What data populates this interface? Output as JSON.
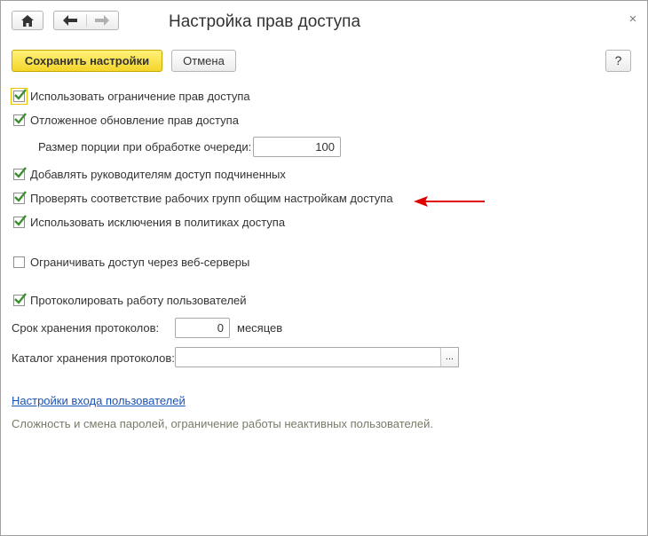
{
  "window": {
    "title": "Настройка прав доступа",
    "close_glyph": "×"
  },
  "toolbar": {
    "save_label": "Сохранить настройки",
    "cancel_label": "Отмена",
    "help_label": "?"
  },
  "settings": {
    "use_restriction": {
      "label": "Использовать ограничение прав доступа",
      "checked": true
    },
    "deferred_update": {
      "label": "Отложенное обновление прав доступа",
      "checked": true
    },
    "batch_size": {
      "label": "Размер порции при обработке очереди:",
      "value": "100"
    },
    "managers_access": {
      "label": "Добавлять руководителям доступ подчиненных",
      "checked": true
    },
    "check_workgroups": {
      "label": "Проверять соответствие рабочих групп общим настройкам доступа",
      "checked": true
    },
    "policy_exceptions": {
      "label": "Использовать исключения в политиках доступа",
      "checked": true
    },
    "web_servers": {
      "label": "Ограничивать доступ через веб-серверы",
      "checked": false
    },
    "log_users": {
      "label": "Протоколировать работу пользователей",
      "checked": true
    },
    "retention": {
      "label": "Срок хранения протоколов:",
      "value": "0",
      "unit": "месяцев"
    },
    "log_catalog": {
      "label": "Каталог хранения протоколов:",
      "value": "",
      "button_label": "..."
    }
  },
  "footer": {
    "link_label": "Настройки входа пользователей",
    "description": "Сложность и смена паролей, ограничение работы неактивных пользователей."
  },
  "colors": {
    "accent_yellow": "#f5d52a",
    "link_blue": "#1a52b4",
    "check_green": "#3c8f2f",
    "annotation_red": "#e00000"
  }
}
